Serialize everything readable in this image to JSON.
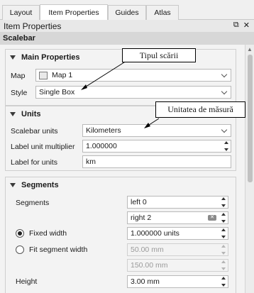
{
  "tabs": [
    {
      "label": "Layout"
    },
    {
      "label": "Item Properties"
    },
    {
      "label": "Guides"
    },
    {
      "label": "Atlas"
    }
  ],
  "panel": {
    "title": "Item Properties",
    "float_icon": "⧉",
    "close_icon": "✕"
  },
  "section": {
    "title": "Scalebar"
  },
  "main_properties": {
    "title": "Main Properties",
    "map_label": "Map",
    "map_value": "Map 1",
    "style_label": "Style",
    "style_value": "Single Box"
  },
  "units": {
    "title": "Units",
    "scalebar_units_label": "Scalebar units",
    "scalebar_units_value": "Kilometers",
    "label_multiplier_label": "Label unit multiplier",
    "label_multiplier_value": "1.000000",
    "label_for_units_label": "Label for units",
    "label_for_units_value": "km"
  },
  "segments": {
    "title": "Segments",
    "segments_label": "Segments",
    "left_value": "left 0",
    "right_value": "right 2",
    "fixed_width_label": "Fixed width",
    "fixed_width_value": "1.000000 units",
    "fit_width_label": "Fit segment width",
    "fit_min_value": "50.00 mm",
    "fit_max_value": "150.00 mm",
    "height_label": "Height",
    "height_value": "3.00 mm"
  },
  "annotations": {
    "style_callout": "Tipul scării",
    "units_callout": "Unitatea de măsură"
  }
}
